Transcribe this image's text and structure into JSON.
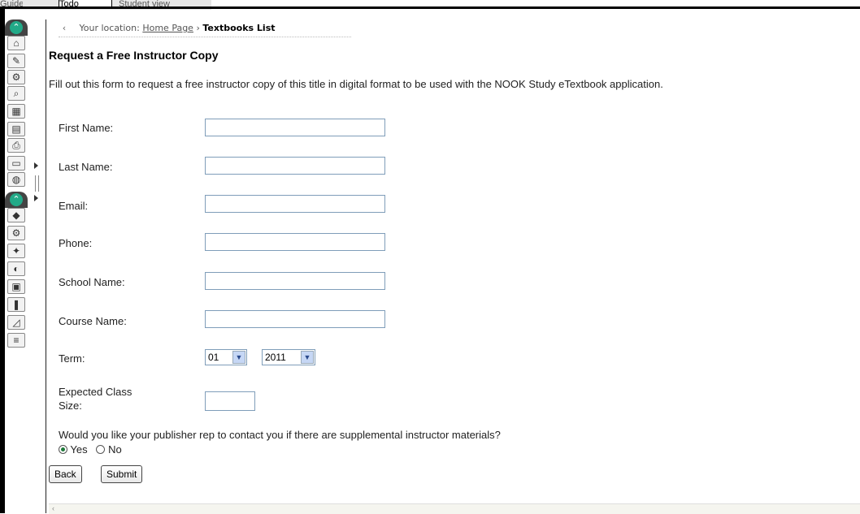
{
  "window": {
    "tabs": [
      "Guide",
      "Todo",
      "Student view"
    ]
  },
  "toolbar": {
    "group1": [
      "collapse-icon",
      "home-icon",
      "edit-icon",
      "tools-icon",
      "search-icon",
      "grid-icon",
      "document-icon",
      "publish-icon",
      "folder-icon",
      "globe-icon"
    ],
    "group2": [
      "collapse-icon",
      "cube-icon",
      "tools-icon",
      "puzzle-icon",
      "paint-icon",
      "map-icon",
      "books-icon",
      "chart-icon",
      "stack-icon"
    ]
  },
  "breadcrumb": {
    "prefix": "Your location:",
    "home": "Home Page",
    "separator": "›",
    "current": "Textbooks List"
  },
  "page": {
    "title": "Request a Free Instructor Copy",
    "description": "Fill out this form to request a free instructor copy of this title in digital format to be used with the NOOK Study eTextbook application."
  },
  "form": {
    "first_name_label": "First Name:",
    "last_name_label": "Last Name:",
    "email_label": "Email:",
    "phone_label": "Phone:",
    "school_label": "School Name:",
    "course_label": "Course Name:",
    "term_label": "Term:",
    "term_month": "01",
    "term_year": "2011",
    "class_size_label_1": "Expected Class",
    "class_size_label_2": "Size:",
    "contact_question": "Would you like your publisher rep to contact you if there are supplemental instructor materials?",
    "yes_label": "Yes",
    "no_label": "No",
    "selected": "Yes",
    "back_label": "Back",
    "submit_label": "Submit"
  },
  "footer": {
    "scroll_glyph": "‹"
  }
}
